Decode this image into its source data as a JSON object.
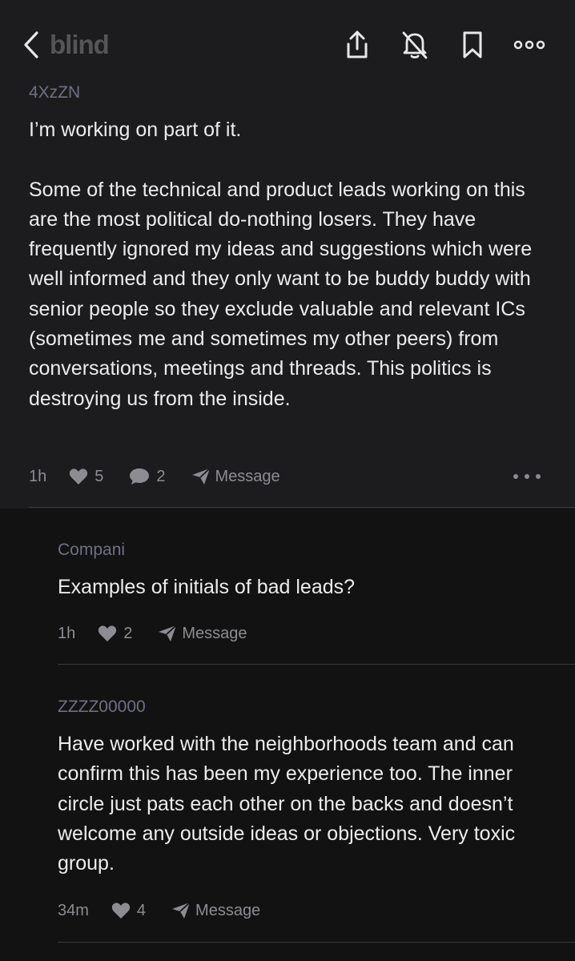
{
  "header": {
    "brand": "blind",
    "icons": [
      "back-chevron-icon",
      "share-icon",
      "notifications-off-icon",
      "bookmark-icon",
      "more-icon"
    ]
  },
  "post": {
    "author": "4XzZN",
    "text": "I’m working on part of it.\n\nSome of the technical and product leads working on this are the most political do-nothing losers. They have frequently ignored my ideas and suggestions which were well informed and they only want to be buddy buddy with senior people so they exclude valuable and relevant ICs (sometimes me and sometimes my other peers) from conversations, meetings and threads. This politics is destroying us from the inside.",
    "time": "1h",
    "likes": "5",
    "comments": "2",
    "message_label": "Message"
  },
  "replies": [
    {
      "author": "Compani",
      "text": "Examples of initials of bad leads?",
      "time": "1h",
      "likes": "2",
      "message_label": "Message"
    },
    {
      "author": "ZZZZ00000",
      "text": "Have worked with the neighborhoods team and can confirm this has been my experience too. The inner circle just pats each other on the backs and doesn’t welcome any outside ideas or objections. Very toxic group.",
      "time": "34m",
      "likes": "4",
      "message_label": "Message"
    }
  ],
  "colors": {
    "background": "#121212",
    "card": "#1c1c1e",
    "author": "#6f6f86",
    "meta": "#8c8c92"
  }
}
